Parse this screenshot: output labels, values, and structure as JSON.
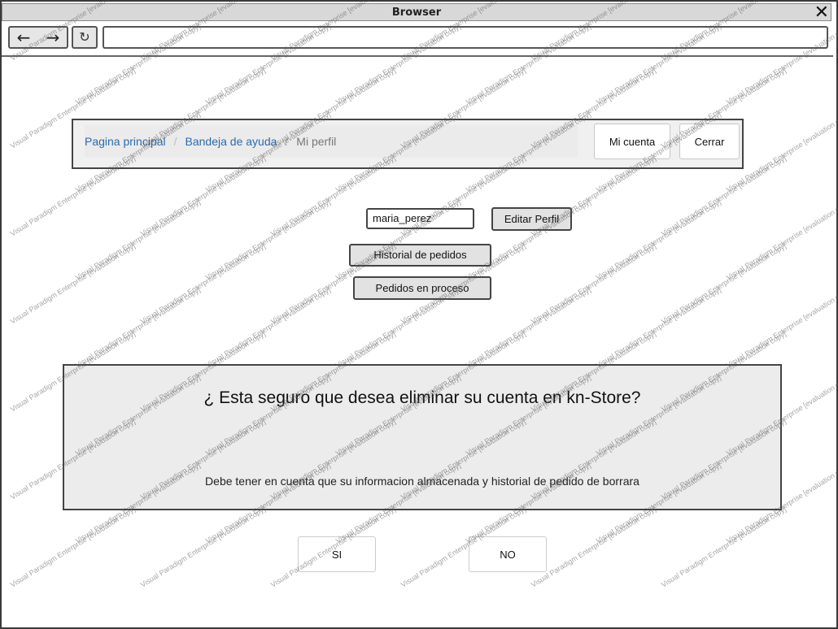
{
  "window": {
    "title": "Browser",
    "close_icon": "✕"
  },
  "toolbar": {
    "back_icon": "←",
    "forward_icon": "→",
    "reload_icon": "↻",
    "url": ""
  },
  "navbar": {
    "breadcrumb": [
      {
        "label": "Pagina principal"
      },
      {
        "label": "Bandeja de ayuda"
      },
      {
        "label": "Mi perfil"
      }
    ],
    "separator": "/",
    "account_label": "Mi cuenta",
    "logout_label": "Cerrar"
  },
  "profile": {
    "username": "maria_perez",
    "edit_label": "Editar Perfil",
    "history_label": "Historial de pedidos",
    "in_process_label": "Pedidos en proceso"
  },
  "dialog": {
    "question": "¿ Esta seguro que desea eliminar su cuenta en kn-Store?",
    "note": "Debe tener en cuenta que su informacion almacenada y historial de pedido de borrara",
    "yes_label": "SI",
    "no_label": "NO"
  },
  "watermark_text": "Visual Paradigm Enterprise [evaluation copy]",
  "colors": {
    "link": "#2a6bb0",
    "breadcrumb_current": "#777777",
    "panel_bg": "#ececec"
  }
}
